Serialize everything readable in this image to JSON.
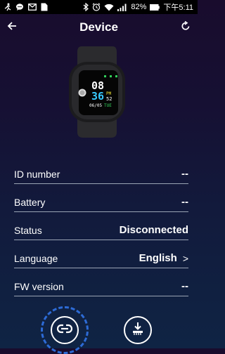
{
  "status_bar": {
    "battery_percent": "82%",
    "time": "下午5:11"
  },
  "header": {
    "title": "Device"
  },
  "watch": {
    "hour": "08",
    "minute": "36",
    "ampm": "PM",
    "seconds": "52",
    "date": "06/05",
    "day": "TUE"
  },
  "info_rows": [
    {
      "label": "ID number",
      "value": "--"
    },
    {
      "label": "Battery",
      "value": "--"
    },
    {
      "label": "Status",
      "value": "Disconnected"
    },
    {
      "label": "Language",
      "value": "English"
    },
    {
      "label": "FW version",
      "value": "--"
    }
  ],
  "colors": {
    "accent_ring": "#2d6bd6",
    "watch_green": "#32d25c",
    "watch_cyan": "#37c9ff",
    "watch_yellow": "#f2e233"
  }
}
